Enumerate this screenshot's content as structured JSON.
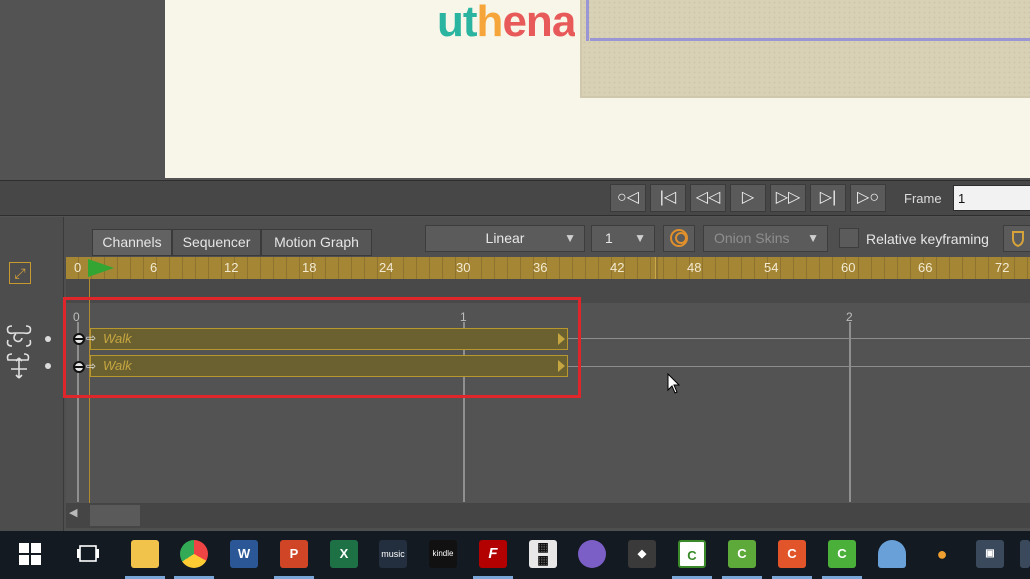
{
  "canvas": {
    "logo_text": [
      "u",
      "t",
      "h",
      "e",
      "n",
      "a"
    ],
    "logo_colors": [
      "#2bb5a0",
      "#2bb5a0",
      "#f5a53a",
      "#e85a5a",
      "#e85a5a",
      "#e85a5a"
    ]
  },
  "transport": {
    "buttons": [
      "go-to-start",
      "previous-keyframe",
      "rewind",
      "play",
      "fast-forward",
      "next-keyframe",
      "go-to-end"
    ],
    "frame_label": "Frame",
    "frame_value": "1"
  },
  "tabs": [
    "Channels",
    "Sequencer",
    "Motion Graph"
  ],
  "toolbar": {
    "interpolation": "Linear",
    "step": "1",
    "onion_skins": "Onion Skins",
    "relative_keyframing": "Relative keyframing"
  },
  "ruler": {
    "ticks": [
      "0",
      "6",
      "12",
      "18",
      "24",
      "30",
      "36",
      "42",
      "48",
      "54",
      "60",
      "66",
      "72"
    ]
  },
  "sequencer": {
    "second_markers": [
      "0",
      "1",
      "2"
    ],
    "clips": [
      {
        "label": "Walk",
        "track_icon": "bone-rotate-icon"
      },
      {
        "label": "Walk",
        "track_icon": "bone-move-icon"
      }
    ]
  },
  "taskbar": {
    "apps": [
      "start",
      "task-view",
      "file-explorer",
      "chrome",
      "word",
      "powerpoint",
      "excel",
      "amazon-music",
      "kindle",
      "filezilla",
      "calculator",
      "app-purple",
      "gimp",
      "camtasia",
      "camtasia",
      "camtasia",
      "camtasia",
      "cloud-app",
      "app-flame",
      "network-app"
    ],
    "tile_labels": {
      "word": "W",
      "powerpoint": "P",
      "excel": "X",
      "amazon_music": "music",
      "kindle": "kindle",
      "camtasia": "C"
    }
  },
  "colors": {
    "ruler": "#a58635",
    "clip_border": "#b8972e",
    "selection": "#e0262a",
    "playhead": "#33a532"
  }
}
